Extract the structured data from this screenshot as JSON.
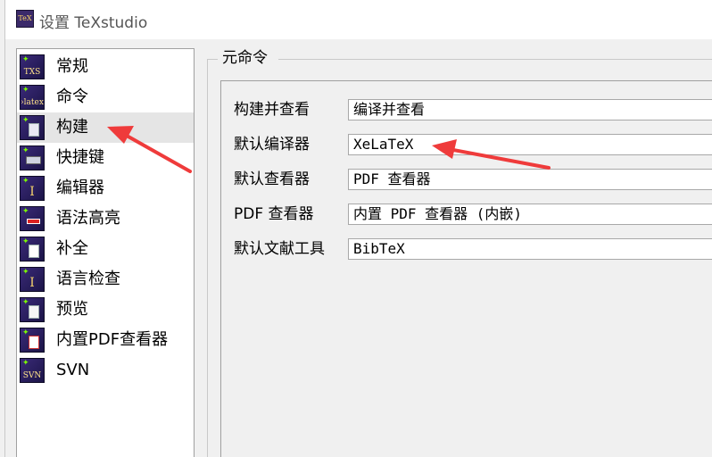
{
  "window": {
    "title": "设置 TeXstudio",
    "app_icon": "texstudio-logo-icon"
  },
  "sidebar": {
    "selected_index": 2,
    "items": [
      {
        "label": "常规",
        "icon": "txs-icon",
        "icon_text": "TXS"
      },
      {
        "label": "命令",
        "icon": "latex-icon",
        "icon_text": "›latex"
      },
      {
        "label": "构建",
        "icon": "build-doc-icon",
        "icon_text": ""
      },
      {
        "label": "快捷键",
        "icon": "keyboard-icon",
        "icon_text": ""
      },
      {
        "label": "编辑器",
        "icon": "editor-cursor-icon",
        "icon_text": "I"
      },
      {
        "label": "语法高亮",
        "icon": "syntax-highlight-icon",
        "icon_text": ""
      },
      {
        "label": "补全",
        "icon": "completion-icon",
        "icon_text": ""
      },
      {
        "label": "语言检查",
        "icon": "language-check-icon",
        "icon_text": "I"
      },
      {
        "label": "预览",
        "icon": "preview-icon",
        "icon_text": ""
      },
      {
        "label": "内置PDF查看器",
        "icon": "pdf-viewer-icon",
        "icon_text": ""
      },
      {
        "label": "SVN",
        "icon": "svn-icon",
        "icon_text": "SVN"
      }
    ]
  },
  "content": {
    "group_title": "元命令",
    "rows": [
      {
        "label": "构建并查看",
        "value": "编译并查看"
      },
      {
        "label": "默认编译器",
        "value": "XeLaTeX"
      },
      {
        "label": "默认查看器",
        "value": "PDF 查看器"
      },
      {
        "label": "PDF 查看器",
        "value": "内置 PDF 查看器 (内嵌)"
      },
      {
        "label": "默认文献工具",
        "value": "BibTeX"
      }
    ]
  },
  "colors": {
    "annotation_arrow": "#ef3b3b",
    "selection": "#e5e5e5",
    "icon_bg": "#2a1f5e"
  }
}
